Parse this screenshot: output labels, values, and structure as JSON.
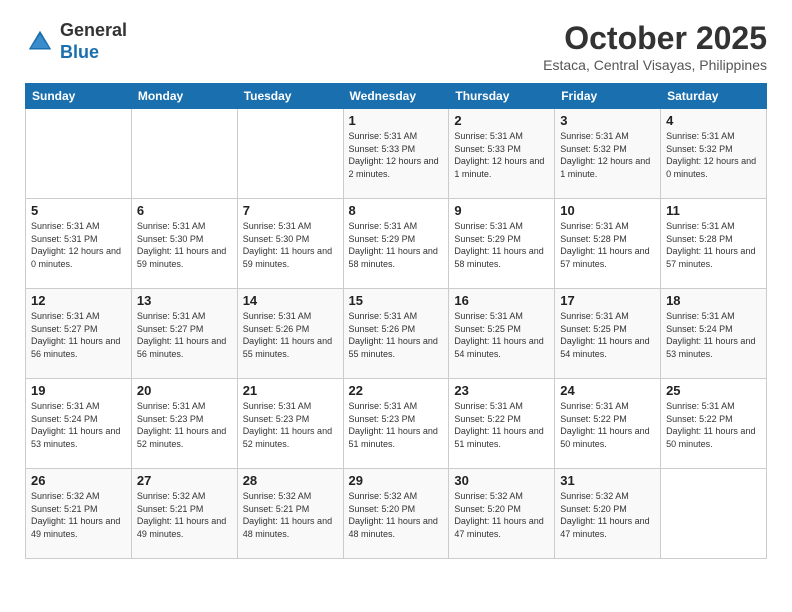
{
  "header": {
    "logo": {
      "general": "General",
      "blue": "Blue"
    },
    "title": "October 2025",
    "subtitle": "Estaca, Central Visayas, Philippines"
  },
  "weekdays": [
    "Sunday",
    "Monday",
    "Tuesday",
    "Wednesday",
    "Thursday",
    "Friday",
    "Saturday"
  ],
  "weeks": [
    [
      {
        "day": "",
        "sunrise": "",
        "sunset": "",
        "daylight": ""
      },
      {
        "day": "",
        "sunrise": "",
        "sunset": "",
        "daylight": ""
      },
      {
        "day": "",
        "sunrise": "",
        "sunset": "",
        "daylight": ""
      },
      {
        "day": "1",
        "sunrise": "Sunrise: 5:31 AM",
        "sunset": "Sunset: 5:33 PM",
        "daylight": "Daylight: 12 hours and 2 minutes."
      },
      {
        "day": "2",
        "sunrise": "Sunrise: 5:31 AM",
        "sunset": "Sunset: 5:33 PM",
        "daylight": "Daylight: 12 hours and 1 minute."
      },
      {
        "day": "3",
        "sunrise": "Sunrise: 5:31 AM",
        "sunset": "Sunset: 5:32 PM",
        "daylight": "Daylight: 12 hours and 1 minute."
      },
      {
        "day": "4",
        "sunrise": "Sunrise: 5:31 AM",
        "sunset": "Sunset: 5:32 PM",
        "daylight": "Daylight: 12 hours and 0 minutes."
      }
    ],
    [
      {
        "day": "5",
        "sunrise": "Sunrise: 5:31 AM",
        "sunset": "Sunset: 5:31 PM",
        "daylight": "Daylight: 12 hours and 0 minutes."
      },
      {
        "day": "6",
        "sunrise": "Sunrise: 5:31 AM",
        "sunset": "Sunset: 5:30 PM",
        "daylight": "Daylight: 11 hours and 59 minutes."
      },
      {
        "day": "7",
        "sunrise": "Sunrise: 5:31 AM",
        "sunset": "Sunset: 5:30 PM",
        "daylight": "Daylight: 11 hours and 59 minutes."
      },
      {
        "day": "8",
        "sunrise": "Sunrise: 5:31 AM",
        "sunset": "Sunset: 5:29 PM",
        "daylight": "Daylight: 11 hours and 58 minutes."
      },
      {
        "day": "9",
        "sunrise": "Sunrise: 5:31 AM",
        "sunset": "Sunset: 5:29 PM",
        "daylight": "Daylight: 11 hours and 58 minutes."
      },
      {
        "day": "10",
        "sunrise": "Sunrise: 5:31 AM",
        "sunset": "Sunset: 5:28 PM",
        "daylight": "Daylight: 11 hours and 57 minutes."
      },
      {
        "day": "11",
        "sunrise": "Sunrise: 5:31 AM",
        "sunset": "Sunset: 5:28 PM",
        "daylight": "Daylight: 11 hours and 57 minutes."
      }
    ],
    [
      {
        "day": "12",
        "sunrise": "Sunrise: 5:31 AM",
        "sunset": "Sunset: 5:27 PM",
        "daylight": "Daylight: 11 hours and 56 minutes."
      },
      {
        "day": "13",
        "sunrise": "Sunrise: 5:31 AM",
        "sunset": "Sunset: 5:27 PM",
        "daylight": "Daylight: 11 hours and 56 minutes."
      },
      {
        "day": "14",
        "sunrise": "Sunrise: 5:31 AM",
        "sunset": "Sunset: 5:26 PM",
        "daylight": "Daylight: 11 hours and 55 minutes."
      },
      {
        "day": "15",
        "sunrise": "Sunrise: 5:31 AM",
        "sunset": "Sunset: 5:26 PM",
        "daylight": "Daylight: 11 hours and 55 minutes."
      },
      {
        "day": "16",
        "sunrise": "Sunrise: 5:31 AM",
        "sunset": "Sunset: 5:25 PM",
        "daylight": "Daylight: 11 hours and 54 minutes."
      },
      {
        "day": "17",
        "sunrise": "Sunrise: 5:31 AM",
        "sunset": "Sunset: 5:25 PM",
        "daylight": "Daylight: 11 hours and 54 minutes."
      },
      {
        "day": "18",
        "sunrise": "Sunrise: 5:31 AM",
        "sunset": "Sunset: 5:24 PM",
        "daylight": "Daylight: 11 hours and 53 minutes."
      }
    ],
    [
      {
        "day": "19",
        "sunrise": "Sunrise: 5:31 AM",
        "sunset": "Sunset: 5:24 PM",
        "daylight": "Daylight: 11 hours and 53 minutes."
      },
      {
        "day": "20",
        "sunrise": "Sunrise: 5:31 AM",
        "sunset": "Sunset: 5:23 PM",
        "daylight": "Daylight: 11 hours and 52 minutes."
      },
      {
        "day": "21",
        "sunrise": "Sunrise: 5:31 AM",
        "sunset": "Sunset: 5:23 PM",
        "daylight": "Daylight: 11 hours and 52 minutes."
      },
      {
        "day": "22",
        "sunrise": "Sunrise: 5:31 AM",
        "sunset": "Sunset: 5:23 PM",
        "daylight": "Daylight: 11 hours and 51 minutes."
      },
      {
        "day": "23",
        "sunrise": "Sunrise: 5:31 AM",
        "sunset": "Sunset: 5:22 PM",
        "daylight": "Daylight: 11 hours and 51 minutes."
      },
      {
        "day": "24",
        "sunrise": "Sunrise: 5:31 AM",
        "sunset": "Sunset: 5:22 PM",
        "daylight": "Daylight: 11 hours and 50 minutes."
      },
      {
        "day": "25",
        "sunrise": "Sunrise: 5:31 AM",
        "sunset": "Sunset: 5:22 PM",
        "daylight": "Daylight: 11 hours and 50 minutes."
      }
    ],
    [
      {
        "day": "26",
        "sunrise": "Sunrise: 5:32 AM",
        "sunset": "Sunset: 5:21 PM",
        "daylight": "Daylight: 11 hours and 49 minutes."
      },
      {
        "day": "27",
        "sunrise": "Sunrise: 5:32 AM",
        "sunset": "Sunset: 5:21 PM",
        "daylight": "Daylight: 11 hours and 49 minutes."
      },
      {
        "day": "28",
        "sunrise": "Sunrise: 5:32 AM",
        "sunset": "Sunset: 5:21 PM",
        "daylight": "Daylight: 11 hours and 48 minutes."
      },
      {
        "day": "29",
        "sunrise": "Sunrise: 5:32 AM",
        "sunset": "Sunset: 5:20 PM",
        "daylight": "Daylight: 11 hours and 48 minutes."
      },
      {
        "day": "30",
        "sunrise": "Sunrise: 5:32 AM",
        "sunset": "Sunset: 5:20 PM",
        "daylight": "Daylight: 11 hours and 47 minutes."
      },
      {
        "day": "31",
        "sunrise": "Sunrise: 5:32 AM",
        "sunset": "Sunset: 5:20 PM",
        "daylight": "Daylight: 11 hours and 47 minutes."
      },
      {
        "day": "",
        "sunrise": "",
        "sunset": "",
        "daylight": ""
      }
    ]
  ]
}
